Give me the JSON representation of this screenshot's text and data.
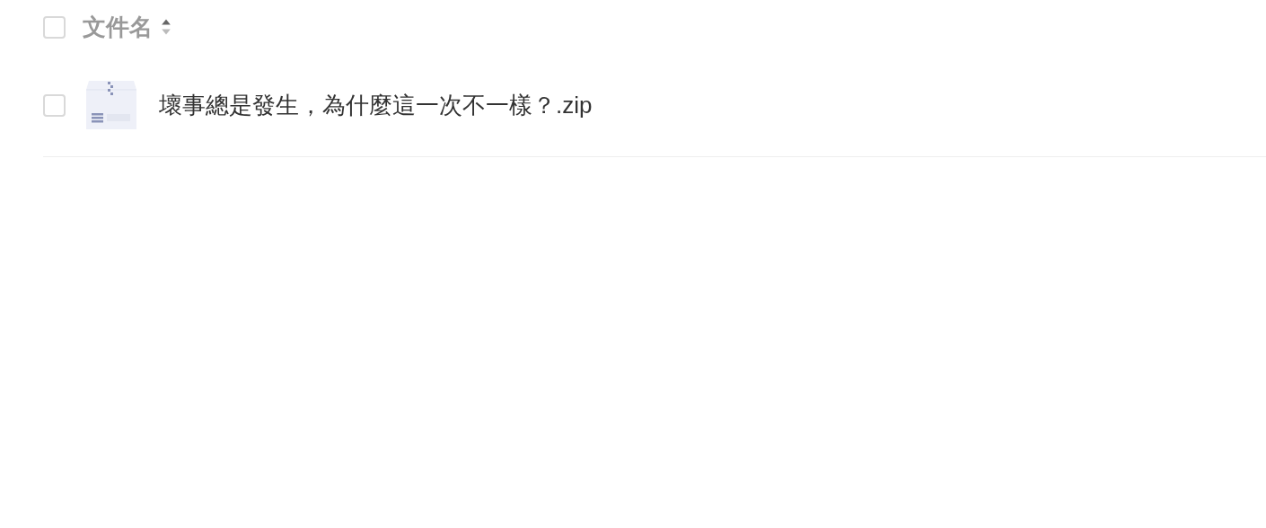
{
  "header": {
    "checked": false,
    "label": "文件名",
    "sorted_ascending": true
  },
  "rows": [
    {
      "checked": false,
      "kind": "zip",
      "name": "壞事總是發生，為什麼這一次不一樣？.zip"
    }
  ]
}
